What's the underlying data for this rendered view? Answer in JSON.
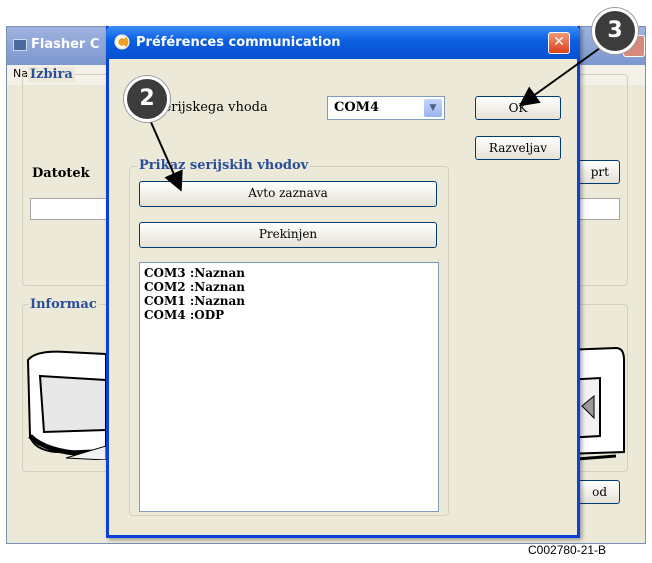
{
  "background_window": {
    "title": "Flasher C",
    "menu_item": "Nastavitve",
    "group_selection_label": "Izbira",
    "file_label": "Datotek",
    "browse_button_label": "prt",
    "group_info_label": "Informac",
    "exit_button_label": "od"
  },
  "dialog": {
    "title": "Préférences communication",
    "port_label": "a serijskega vhoda",
    "port_selected": "COM4",
    "ok_label": "OK",
    "cancel_label": "Razveljav",
    "ports_group_label": "Prikaz serijskih vhodov",
    "autodetect_label": "Avto zaznava",
    "disconnect_label": "Prekinjen",
    "port_list": [
      "COM3 :Naznan",
      "COM2 :Naznan",
      "COM1 :Naznan",
      "COM4 :ODP"
    ]
  },
  "callouts": [
    "2",
    "3"
  ],
  "caption": "C002780-21-B",
  "colors": {
    "dialog_title_bar": "#0a5fe0",
    "group_label": "#2a4f9a",
    "window_bg": "#ece9d8",
    "callout_bg": "#3c3c3c"
  }
}
